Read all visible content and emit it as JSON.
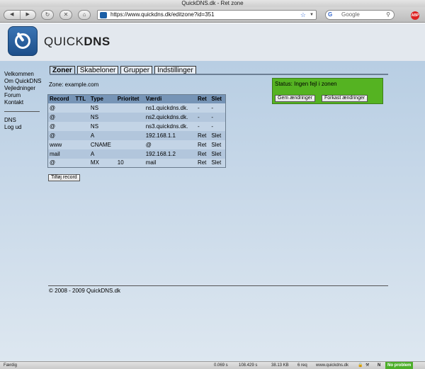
{
  "window": {
    "title": "QuickDNS.dk - Ret zone"
  },
  "toolbar": {
    "back_icon": "back-arrow-icon",
    "forward_icon": "forward-arrow-icon",
    "reload_label": "↻",
    "stop_label": "✕",
    "home_label": "⌂",
    "url": "https://www.quickdns.dk/editzone?id=351",
    "search_placeholder": "Google",
    "abp_label": "ABP"
  },
  "header": {
    "brand_light": "QUICK",
    "brand_bold": "DNS"
  },
  "sidebar": {
    "items": [
      "Velkommen",
      "Om QuickDNS",
      "Vejledninger",
      "Forum",
      "Kontakt"
    ],
    "items2": [
      "DNS",
      "Log ud"
    ]
  },
  "tabs": [
    "Zoner",
    "Skabeloner",
    "Grupper",
    "Indstillinger"
  ],
  "zone": {
    "label": "Zone: example.com"
  },
  "table": {
    "headers": [
      "Record",
      "TTL",
      "Type",
      "Prioritet",
      "Værdi",
      "Ret",
      "Slet"
    ],
    "rows": [
      [
        "@",
        "",
        "NS",
        "",
        "ns1.quickdns.dk.",
        "-",
        "-"
      ],
      [
        "@",
        "",
        "NS",
        "",
        "ns2.quickdns.dk.",
        "-",
        "-"
      ],
      [
        "@",
        "",
        "NS",
        "",
        "ns3.quickdns.dk.",
        "-",
        "-"
      ],
      [
        "@",
        "",
        "A",
        "",
        "192.168.1.1",
        "Ret",
        "Slet"
      ],
      [
        "www",
        "",
        "CNAME",
        "",
        "@",
        "Ret",
        "Slet"
      ],
      [
        "mail",
        "",
        "A",
        "",
        "192.168.1.2",
        "Ret",
        "Slet"
      ],
      [
        "@",
        "",
        "MX",
        "10",
        "mail",
        "Ret",
        "Slet"
      ]
    ]
  },
  "buttons": {
    "add_record": "Tilføj record",
    "save": "Gem ændringer",
    "discard": "Forkast ændringer"
  },
  "status": {
    "text": "Status: Ingen fejl i zonen",
    "color": "#55b322"
  },
  "footer": {
    "copyright": "© 2008 - 2009 QuickDNS.dk"
  },
  "statusbar": {
    "left": "Færdig",
    "time1": "0.069 s",
    "time2": "108.429 s",
    "size": "38.13 KB",
    "reqs": "6 req",
    "host": "www.quickdns.dk",
    "problem": "No problem"
  }
}
